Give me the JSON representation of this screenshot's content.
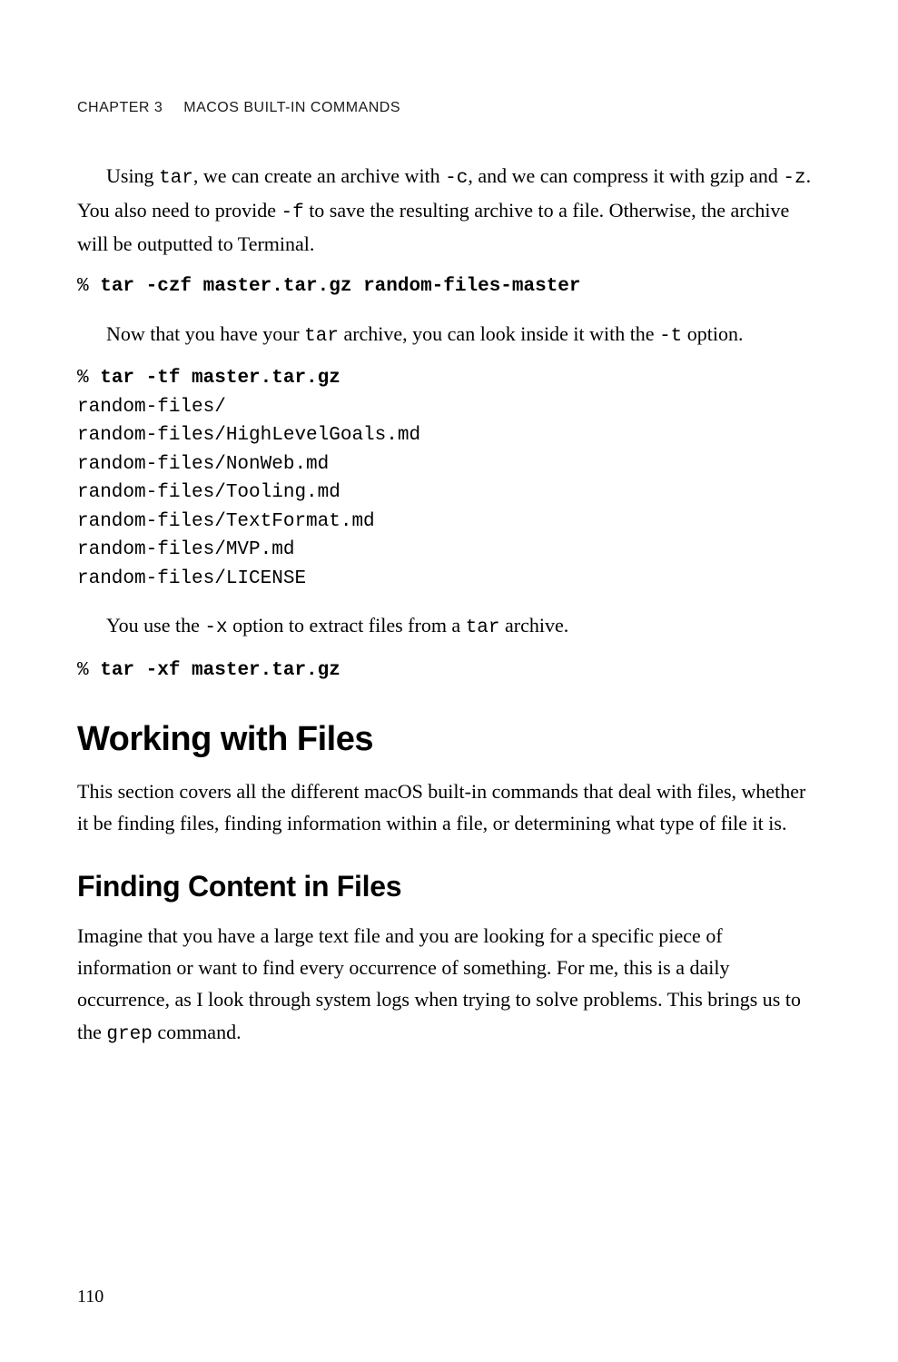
{
  "header": {
    "chapter": "CHAPTER 3",
    "title": "MACOS BUILT-IN COMMANDS"
  },
  "para1": {
    "pre": "Using ",
    "c1": "tar",
    "mid1": ", we can create an archive with ",
    "c2": "-c",
    "mid2": ", and we can compress it with gzip and ",
    "c3": "-z",
    "mid3": ". You also need to provide ",
    "c4": "-f",
    "post": " to save the resulting archive to a file. Otherwise, the archive will be outputted to Terminal."
  },
  "cmd1": {
    "prompt": "% ",
    "command": "tar -czf master.tar.gz random-files-master"
  },
  "para2": {
    "pre": "Now that you have your ",
    "c1": "tar",
    "mid1": " archive, you can look inside it with the ",
    "c2": "-t",
    "post": " option."
  },
  "cmd2": {
    "prompt": "% ",
    "command": "tar -tf master.tar.gz"
  },
  "output2": "random-files/\nrandom-files/HighLevelGoals.md\nrandom-files/NonWeb.md\nrandom-files/Tooling.md\nrandom-files/TextFormat.md\nrandom-files/MVP.md\nrandom-files/LICENSE",
  "para3": {
    "pre": "You use the ",
    "c1": "-x",
    "mid1": " option to extract files from a ",
    "c2": "tar",
    "post": " archive."
  },
  "cmd3": {
    "prompt": "% ",
    "command": "tar -xf master.tar.gz"
  },
  "section1": {
    "heading": "Working with Files",
    "body": "This section covers all the different macOS built-in commands that deal with files, whether it be finding files, finding information within a file, or determining what type of file it is."
  },
  "section2": {
    "heading": "Finding Content in Files",
    "body_pre": "Imagine that you have a large text file and you are looking for a specific piece of information or want to find every occurrence of something. For me, this is a daily occurrence, as I look through system logs when trying to solve problems. This brings us to the ",
    "body_code": "grep",
    "body_post": " command."
  },
  "page_number": "110"
}
